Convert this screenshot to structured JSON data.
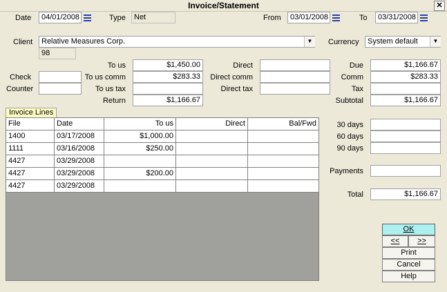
{
  "window": {
    "title": "Invoice/Statement",
    "close_glyph": "✕"
  },
  "header": {
    "date_label": "Date",
    "date_value": "04/01/2008",
    "type_label": "Type",
    "type_value": "Net",
    "from_label": "From",
    "from_value": "03/01/2008",
    "to_label": "To",
    "to_value": "03/31/2008"
  },
  "client": {
    "label": "Client",
    "value": "Relative Measures Corp.",
    "id": "98",
    "currency_label": "Currency",
    "currency_value": "System default"
  },
  "amounts": {
    "to_us_label": "To us",
    "to_us_value": "$1,450.00",
    "to_us_comm_label": "To us comm",
    "to_us_comm_value": "$283.33",
    "to_us_tax_label": "To us tax",
    "to_us_tax_value": "",
    "return_label": "Return",
    "return_value": "$1,166.67",
    "check_label": "Check",
    "check_value": "",
    "counter_label": "Counter",
    "counter_value": "",
    "direct_label": "Direct",
    "direct_value": "",
    "direct_comm_label": "Direct comm",
    "direct_comm_value": "",
    "direct_tax_label": "Direct tax",
    "direct_tax_value": "",
    "due_label": "Due",
    "due_value": "$1,166.67",
    "comm_label": "Comm",
    "comm_value": "$283.33",
    "tax_label": "Tax",
    "tax_value": "",
    "subtotal_label": "Subtotal",
    "subtotal_value": "$1,166.67"
  },
  "aging": {
    "d30_label": "30 days",
    "d30_value": "",
    "d60_label": "60 days",
    "d60_value": "",
    "d90_label": "90 days",
    "d90_value": "",
    "payments_label": "Payments",
    "payments_value": "",
    "total_label": "Total",
    "total_value": "$1,166.67"
  },
  "invoice_lines": {
    "tab_label": "Invoice Lines",
    "columns": [
      "File",
      "Date",
      "To us",
      "Direct",
      "Bal/Fwd"
    ],
    "rows": [
      [
        "1400",
        "03/17/2008",
        "$1,000.00",
        "",
        ""
      ],
      [
        "1111",
        "03/16/2008",
        "$250.00",
        "",
        ""
      ],
      [
        "4427",
        "03/29/2008",
        "",
        "",
        ""
      ],
      [
        "4427",
        "03/29/2008",
        "$200.00",
        "",
        ""
      ],
      [
        "4427",
        "03/29/2008",
        "",
        "",
        ""
      ]
    ]
  },
  "buttons": {
    "ok": "OK",
    "prev": "<<",
    "next": ">>",
    "print": "Print",
    "cancel": "Cancel",
    "help": "Help"
  },
  "colors": {
    "ok_bg": "#aef0f0",
    "tab_bg": "#ffffc4",
    "grid_empty": "#a0a19c",
    "calendar_icon": "#2a3fa8"
  }
}
